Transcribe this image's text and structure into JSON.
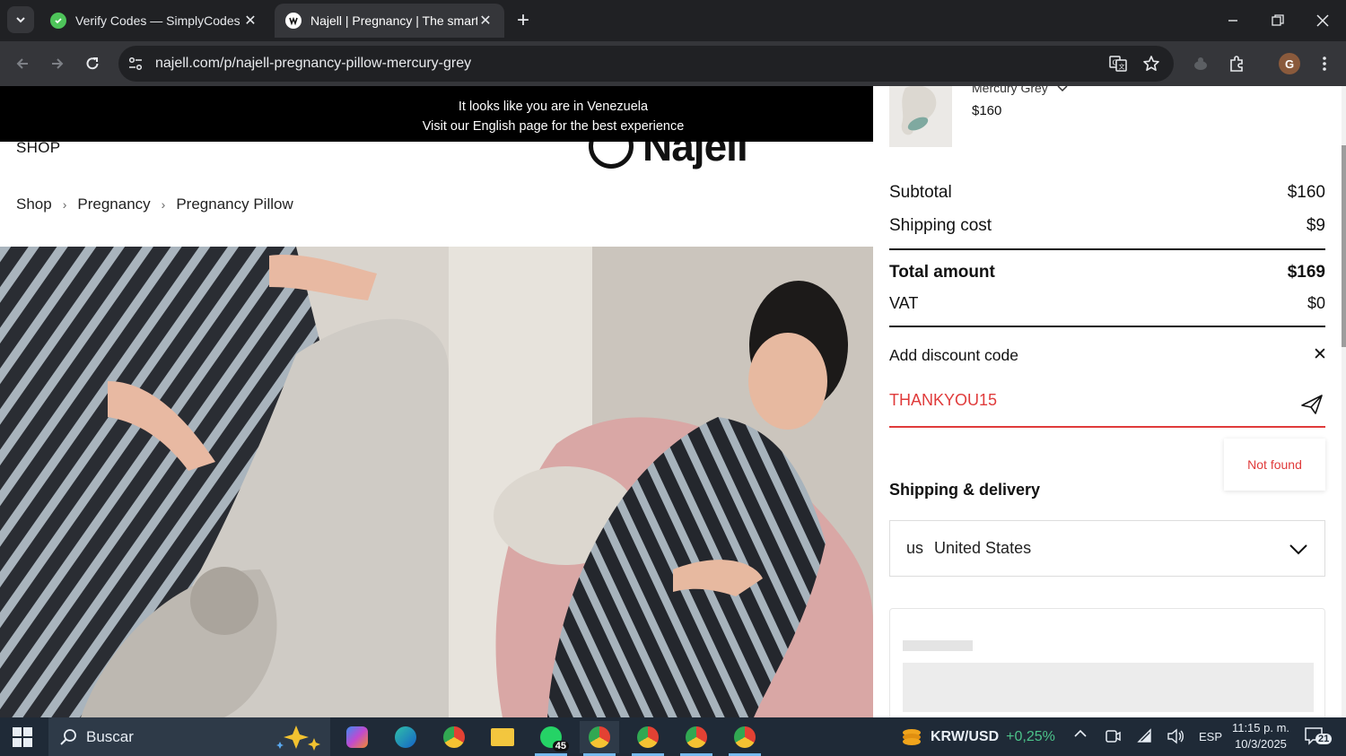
{
  "browser": {
    "tabs": [
      {
        "title": "Verify Codes — SimplyCodes",
        "active": false,
        "favicon_color": "#4ec45a"
      },
      {
        "title": "Najell | Pregnancy | The smarter",
        "active": true,
        "favicon_color": "#ffffff"
      }
    ],
    "url": "najell.com/p/najell-pregnancy-pillow-mercury-grey",
    "profile_initial": "G"
  },
  "site": {
    "geo_banner": {
      "line1": "It looks like you are in Venezuela",
      "line2": "Visit our English page for the best experience"
    },
    "shop_label": "SHOP",
    "logo_text": "Najell",
    "breadcrumb": [
      "Shop",
      "Pregnancy",
      "Pregnancy Pillow"
    ]
  },
  "cart": {
    "item": {
      "variant": "Mercury Grey",
      "price": "$160"
    },
    "subtotal": {
      "label": "Subtotal",
      "value": "$160"
    },
    "shipping": {
      "label": "Shipping cost",
      "value": "$9"
    },
    "total": {
      "label": "Total amount",
      "value": "$169"
    },
    "vat": {
      "label": "VAT",
      "value": "$0"
    },
    "discount": {
      "title": "Add discount code",
      "code_value": "THANKYOU15",
      "error": "Not found"
    },
    "shipping_delivery": {
      "title": "Shipping & delivery",
      "country_code": "us",
      "country_name": "United States"
    },
    "accent_color": "#e03b3b"
  },
  "taskbar": {
    "search_label": "Buscar",
    "whatsapp_badge": "45",
    "ticker_symbol": "KRW/USD",
    "ticker_change": "+0,25%",
    "language": "ESP",
    "time": "11:15 p. m.",
    "date": "10/3/2025",
    "notification_count": "21"
  }
}
